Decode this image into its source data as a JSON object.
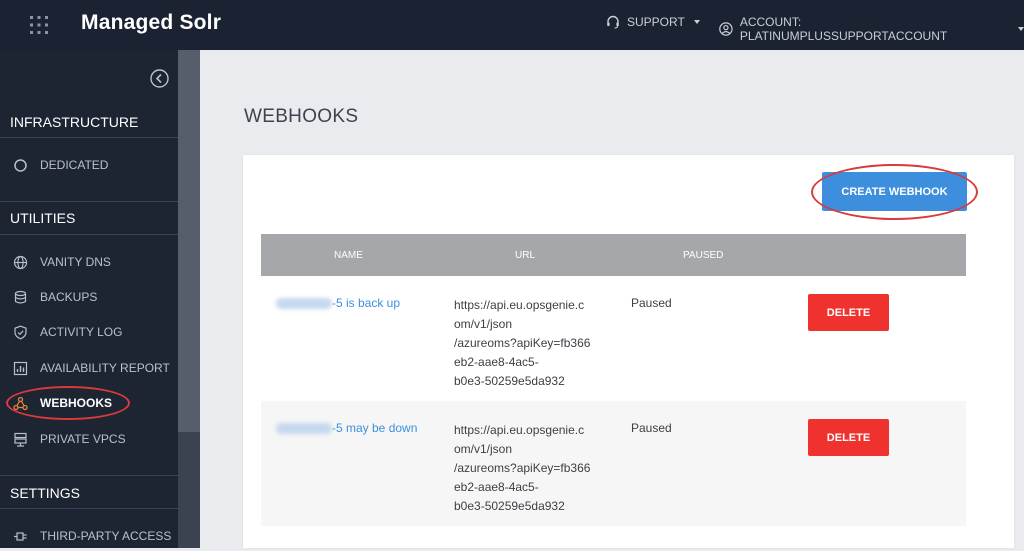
{
  "header": {
    "app_title": "Managed Solr",
    "support_label": "SUPPORT",
    "account_label": "ACCOUNT: PLATINUMPLUSSUPPORTACCOUNT"
  },
  "sidebar": {
    "sections": [
      {
        "title": "INFRASTRUCTURE"
      },
      {
        "title": "UTILITIES"
      },
      {
        "title": "SETTINGS"
      }
    ],
    "items": [
      {
        "label": "DEDICATED",
        "icon": "circle-icon"
      },
      {
        "label": "VANITY DNS",
        "icon": "globe-icon"
      },
      {
        "label": "BACKUPS",
        "icon": "database-icon"
      },
      {
        "label": "ACTIVITY LOG",
        "icon": "shield-check-icon"
      },
      {
        "label": "AVAILABILITY REPORT",
        "icon": "bar-chart-icon"
      },
      {
        "label": "WEBHOOKS",
        "icon": "webhook-icon",
        "active": true
      },
      {
        "label": "PRIVATE VPCS",
        "icon": "server-icon"
      },
      {
        "label": "THIRD-PARTY ACCESS",
        "icon": "plug-icon"
      }
    ]
  },
  "main": {
    "page_title": "WEBHOOKS",
    "create_button": "CREATE WEBHOOK",
    "table": {
      "columns": [
        "NAME",
        "URL",
        "PAUSED"
      ],
      "rows": [
        {
          "name": "-5 is back up",
          "url": "https://api.eu.opsgenie.c\nom/v1/json\n/azureoms?apiKey=fb366\neb2-aae8-4ac5-\nb0e3-50259e5da932",
          "paused": "Paused",
          "action": "DELETE"
        },
        {
          "name": "-5 may be down",
          "url": "https://api.eu.opsgenie.c\nom/v1/json\n/azureoms?apiKey=fb366\neb2-aae8-4ac5-\nb0e3-50259e5da932",
          "paused": "Paused",
          "action": "DELETE"
        }
      ]
    }
  },
  "colors": {
    "topbar": "#1b2332",
    "sidebar": "#1d2532",
    "primary": "#3d8fde",
    "danger": "#f0322f",
    "highlight": "#d93a3a",
    "webhook_icon": "#e8833a"
  }
}
